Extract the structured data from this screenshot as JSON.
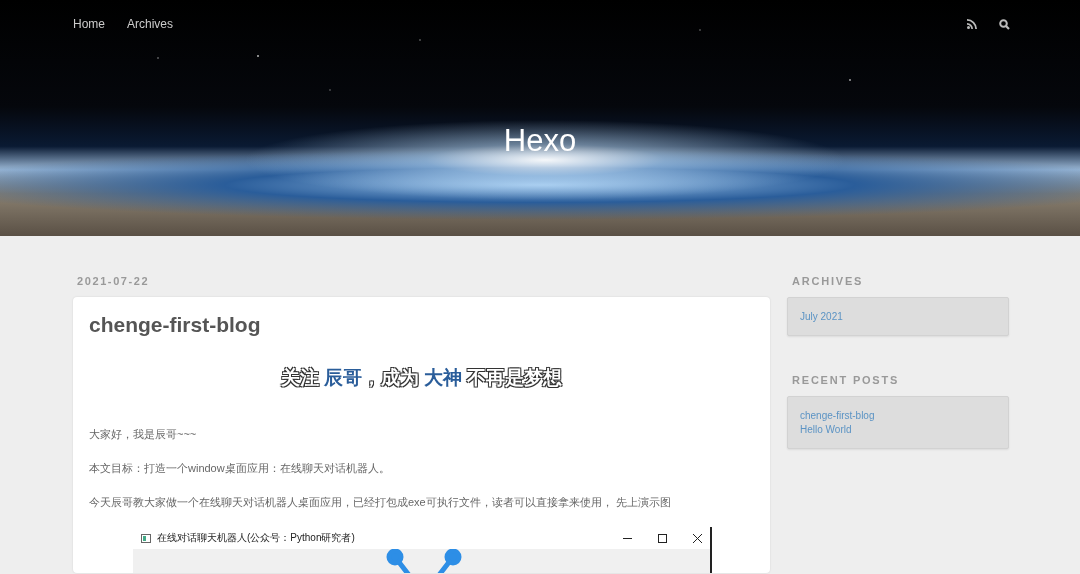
{
  "nav": {
    "links": [
      {
        "label": "Home"
      },
      {
        "label": "Archives"
      }
    ]
  },
  "site": {
    "title": "Hexo"
  },
  "post": {
    "date": "2021-07-22",
    "title": "chenge-first-blog",
    "banner_text": [
      {
        "text": "关注 ",
        "highlight": false
      },
      {
        "text": "辰哥",
        "highlight": true
      },
      {
        "text": "，成为 ",
        "highlight": false
      },
      {
        "text": "大神",
        "highlight": true
      },
      {
        "text": " 不再是梦想",
        "highlight": false
      }
    ],
    "paragraphs": [
      "大家好，我是辰哥~~~",
      "本文目标：打造一个window桌面应用：在线聊天对话机器人。",
      "今天辰哥教大家做一个在线聊天对话机器人桌面应用，已经打包成exe可执行文件，读者可以直接拿来使用， 先上演示图"
    ],
    "app_window": {
      "title": "在线对话聊天机器人(公众号：Python研究者)"
    }
  },
  "sidebar": {
    "widgets": [
      {
        "heading": "ARCHIVES",
        "links": [
          "July 2021"
        ]
      },
      {
        "heading": "RECENT POSTS",
        "links": [
          "chenge-first-blog",
          "Hello World"
        ]
      }
    ]
  }
}
